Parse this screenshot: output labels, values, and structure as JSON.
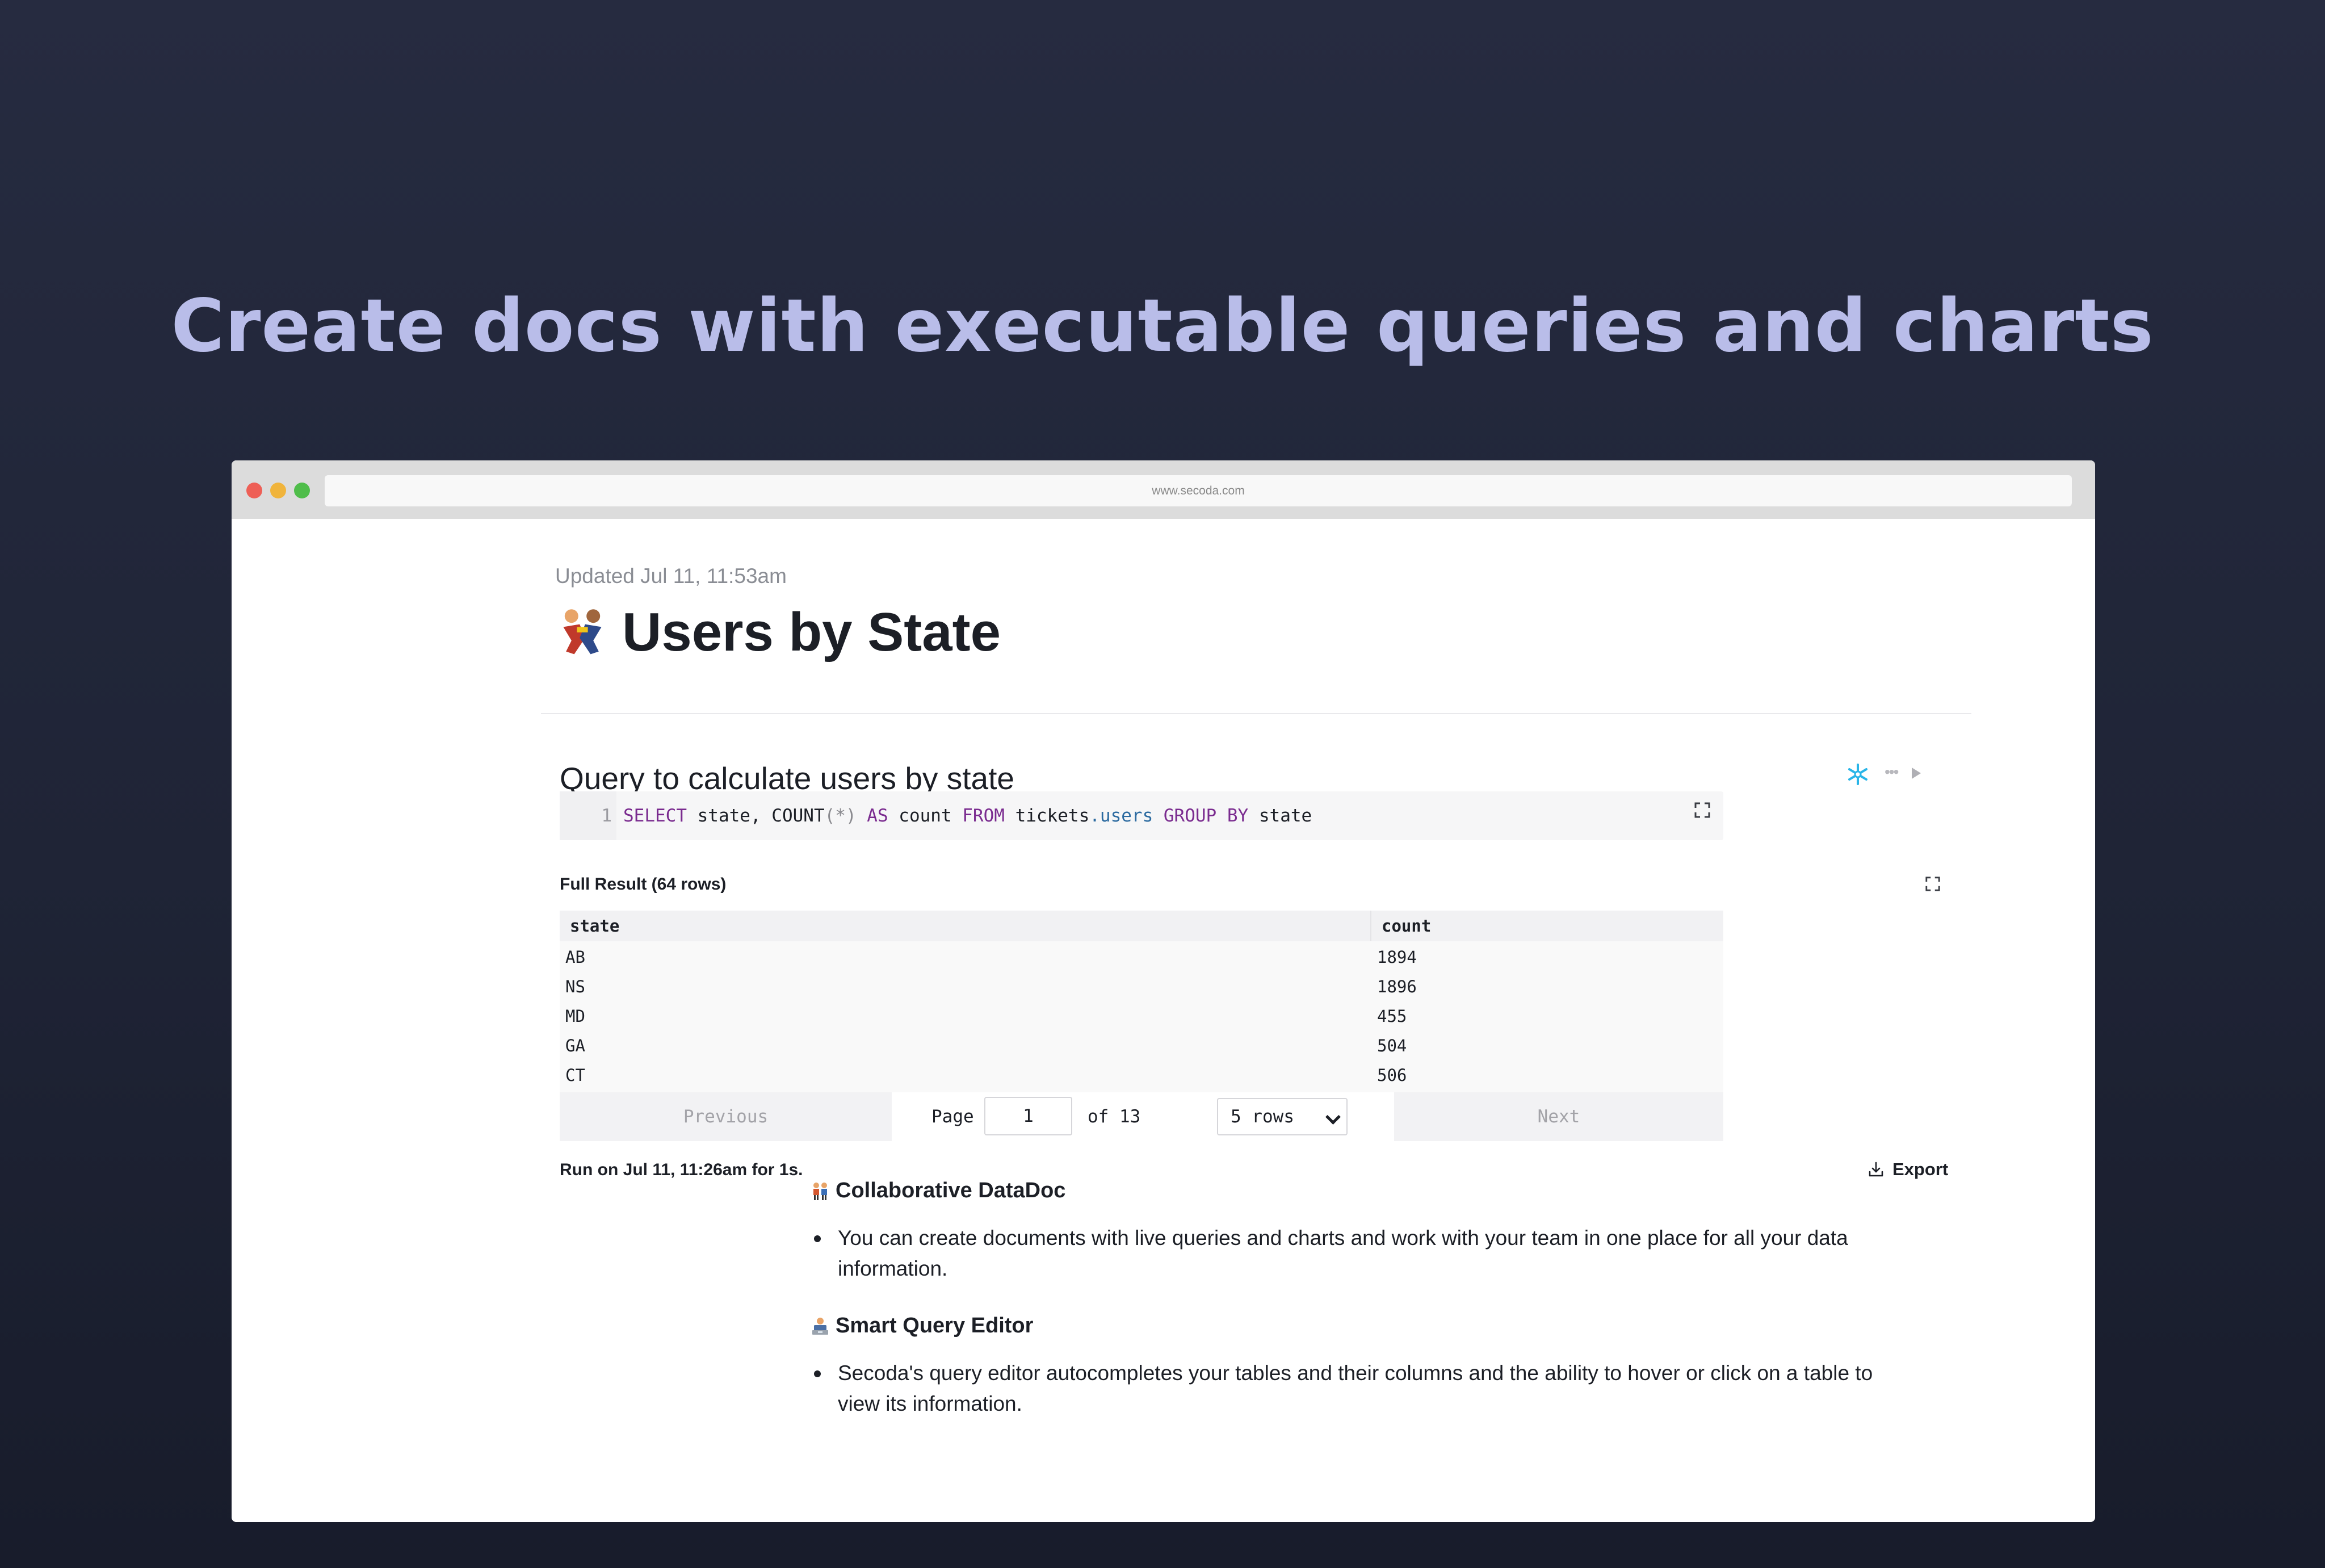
{
  "hero": {
    "headline": "Create docs with executable queries and charts"
  },
  "browser": {
    "url": "www.secoda.com"
  },
  "doc": {
    "updated": "Updated Jul 11, 11:53am",
    "title": "Users by State"
  },
  "query": {
    "title": "Query to calculate users by state",
    "line_number": "1",
    "code_tokens": [
      "SELECT",
      " state, COUNT",
      "(*)",
      " AS",
      " count",
      " FROM",
      " tickets",
      ".users",
      " GROUP BY",
      " state"
    ]
  },
  "results": {
    "label": "Full Result (64 rows)",
    "columns": [
      "state",
      "count"
    ],
    "rows": [
      [
        "AB",
        "1894"
      ],
      [
        "NS",
        "1896"
      ],
      [
        "MD",
        "455"
      ],
      [
        "GA",
        "504"
      ],
      [
        "CT",
        "506"
      ]
    ]
  },
  "pager": {
    "previous": "Previous",
    "page_label": "Page",
    "page_value": "1",
    "of_label": "of 13",
    "rows_option": "5 rows",
    "next": "Next"
  },
  "run_info": "Run on Jul 11, 11:26am for 1s.",
  "export_label": "Export",
  "sections": [
    {
      "heading": "Collaborative DataDoc",
      "bullet": "You can create documents with live queries and charts and work with your team in one place for all your data information."
    },
    {
      "heading": "Smart Query Editor",
      "bullet": "Secoda's query editor autocompletes your tables and their columns and the ability to hover or click on a table to view its information."
    }
  ],
  "colors": {
    "hero_text": "#b9bde9",
    "keyword": "#7a2b8f",
    "table_ref": "#2b6aa0",
    "snowflake": "#29b5e8"
  }
}
